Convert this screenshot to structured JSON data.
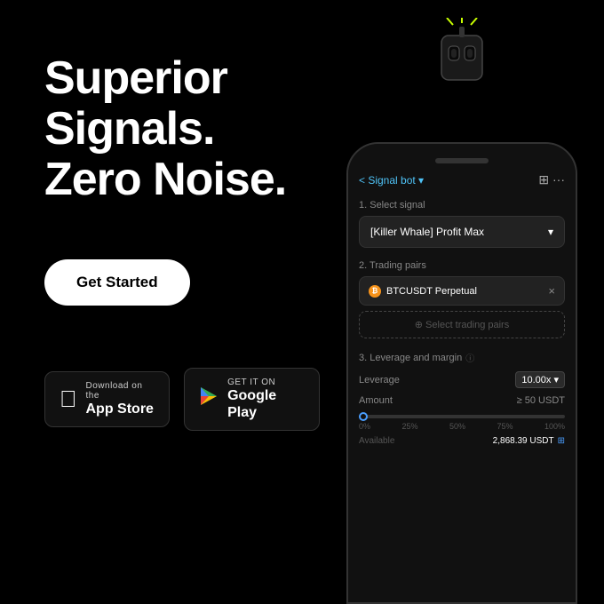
{
  "headline": {
    "line1": "Superior Signals.",
    "line2": "Zero Noise."
  },
  "cta": {
    "label": "Get Started"
  },
  "appstore": {
    "sub": "Download on the",
    "main": "App Store",
    "icon": "apple"
  },
  "googleplay": {
    "sub": "GET IT ON",
    "main": "Google Play",
    "icon": "play"
  },
  "phone": {
    "header": {
      "back": "< Signal bot ▾",
      "icons": "⊞ ···"
    },
    "step1": {
      "label": "1. Select signal",
      "value": "[Killer Whale] Profit Max",
      "chevron": "▾"
    },
    "step2": {
      "label": "2. Trading pairs",
      "tag": "BTCUSDT Perpetual",
      "select_placeholder": "⊕ Select trading pairs"
    },
    "step3": {
      "label": "3. Leverage and margin",
      "leverage_label": "Leverage",
      "leverage_value": "10.00x ▾",
      "amount_label": "Amount",
      "amount_value": "≥ 50 USDT",
      "progress": {
        "labels": [
          "0%",
          "25%",
          "50%",
          "75%",
          "100%"
        ]
      },
      "available_label": "Available",
      "available_value": "2,868.39 USDT"
    }
  },
  "colors": {
    "accent": "#4a9eff",
    "btc": "#f7931a",
    "bg": "#000000",
    "phone_bg": "#111111"
  }
}
